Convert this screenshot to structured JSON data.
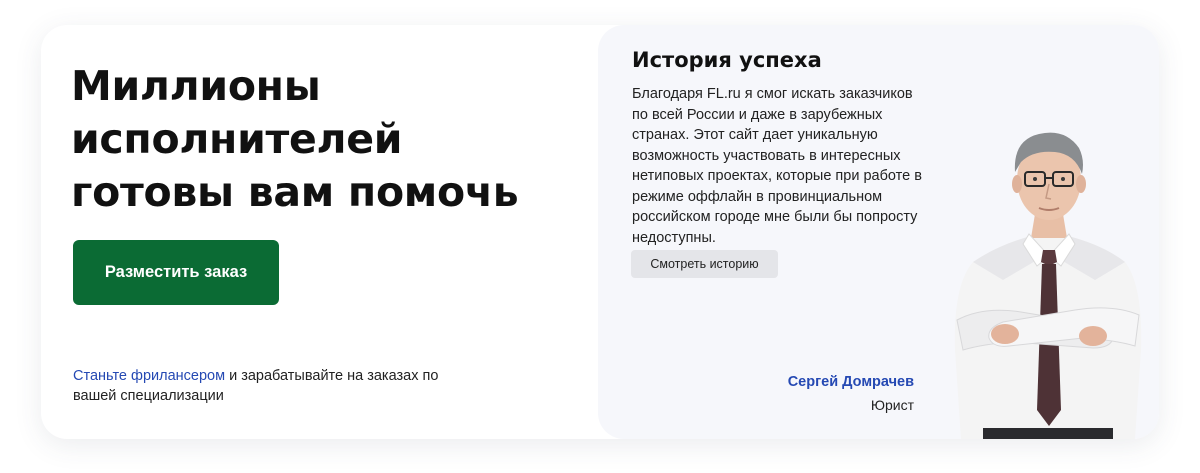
{
  "hero": {
    "title": "Миллионы\nисполнителей\nготовы вам помочь",
    "order_button_label": "Разместить заказ",
    "freelancer_link": "Станьте фрилансером",
    "freelancer_rest": " и зарабатывайте на заказах по вашей специализации"
  },
  "story": {
    "title": "История успеха",
    "text": "Благодаря FL.ru я смог искать заказчиков по всей России и даже в зарубежных странах. Этот сайт дает уникальную возможность участвовать в интересных нетиповых проектах, которые при работе в режиме оффлайн в провинциальном российском городе мне были бы попросту недоступны.",
    "button_label": "Смотреть историю",
    "person_name": "Сергей Домрачев",
    "person_role": "Юрист"
  },
  "colors": {
    "accent_green": "#0b6b34",
    "link_blue": "#2549b3",
    "panel_bg": "#f6f7fb"
  }
}
